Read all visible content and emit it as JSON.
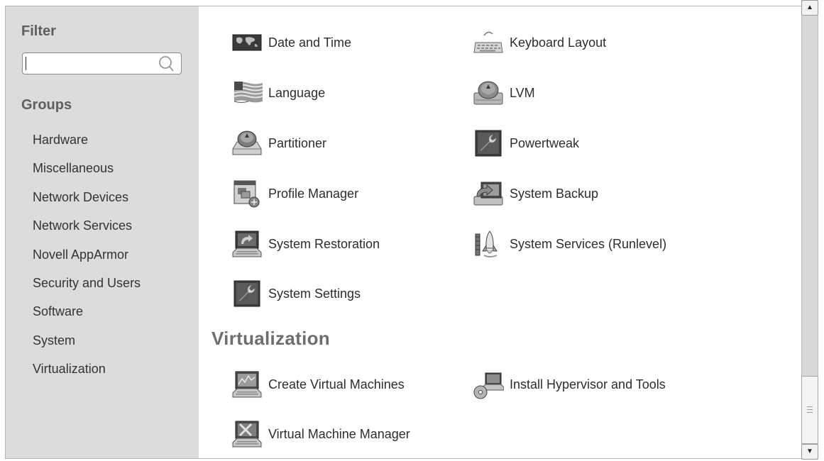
{
  "sidebar": {
    "filter_title": "Filter",
    "filter_value": "",
    "groups_title": "Groups",
    "groups": [
      "Hardware",
      "Miscellaneous",
      "Network Devices",
      "Network Services",
      "Novell AppArmor",
      "Security and Users",
      "Software",
      "System",
      "Virtualization"
    ]
  },
  "system_modules": [
    {
      "label": "Date and Time",
      "icon": "world-map-icon"
    },
    {
      "label": "Keyboard Layout",
      "icon": "keyboard-icon"
    },
    {
      "label": "Language",
      "icon": "flag-icon"
    },
    {
      "label": "LVM",
      "icon": "disk-drive-icon"
    },
    {
      "label": "Partitioner",
      "icon": "hard-disk-icon"
    },
    {
      "label": "Powertweak",
      "icon": "wrench-tool-icon"
    },
    {
      "label": "Profile Manager",
      "icon": "profile-manager-icon"
    },
    {
      "label": "System Backup",
      "icon": "backup-icon"
    },
    {
      "label": "System Restoration",
      "icon": "restore-computer-icon"
    },
    {
      "label": "System Services (Runlevel)",
      "icon": "rocket-launch-icon"
    },
    {
      "label": "System Settings",
      "icon": "wrench-tool-icon"
    }
  ],
  "virtualization": {
    "title": "Virtualization",
    "modules": [
      {
        "label": "Create Virtual Machines",
        "icon": "monitor-chart-icon"
      },
      {
        "label": "Install Hypervisor and Tools",
        "icon": "computer-cd-icon"
      },
      {
        "label": "Virtual Machine Manager",
        "icon": "computer-tools-icon"
      }
    ]
  }
}
